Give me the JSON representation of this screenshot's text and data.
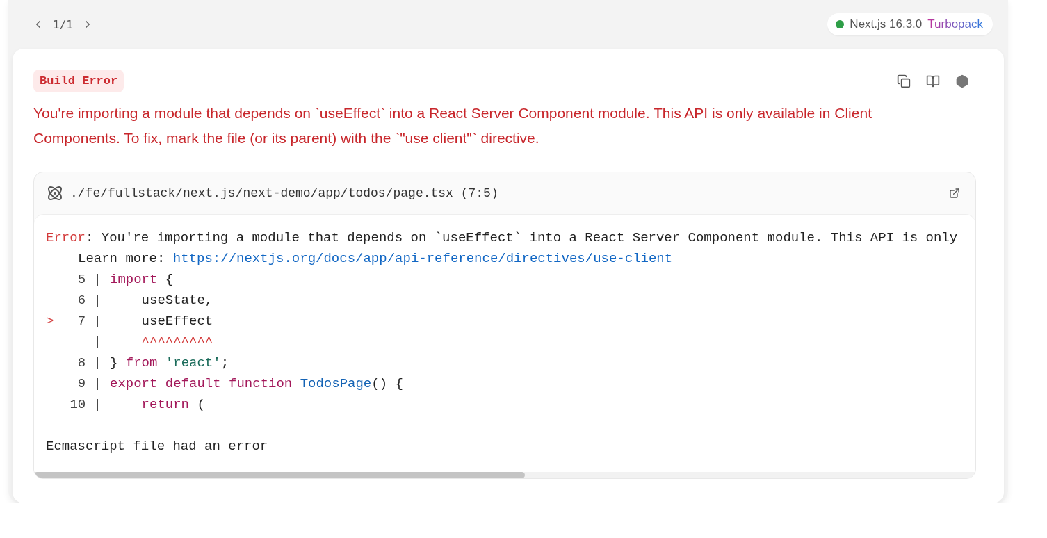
{
  "pager": {
    "count": "1/1"
  },
  "version_badge": {
    "version": "Next.js 16.3.0",
    "bundler": "Turbopack"
  },
  "error_label": "Build Error",
  "message": "You're importing a module that depends on `useEffect` into a React Server Component module. This API is only available in Client Components. To fix, mark the file (or its parent) with the `\"use client\"` directive.",
  "code_frame": {
    "file_path": "./fe/fullstack/next.js/next-demo/app/todos/page.tsx (7:5)",
    "lines": [
      {
        "kind": "error",
        "label": "Error",
        "text": ": You're importing a module that depends on `useEffect` into a React Server Component module. This API is only"
      },
      {
        "kind": "link",
        "label": "Learn more:",
        "text": "https://nextjs.org/docs/app/api-reference/directives/use-client"
      },
      {
        "kind": "code",
        "gutter": "5 |",
        "tokens": [
          {
            "t": "import",
            "kind": "keyword"
          },
          {
            "t": " {",
            "kind": "plain"
          }
        ]
      },
      {
        "kind": "code",
        "gutter": "6 |",
        "tokens": [
          {
            "t": "    useState,",
            "kind": "plain"
          }
        ]
      },
      {
        "kind": "code",
        "marker": ">",
        "gutter": "7 |",
        "tokens": [
          {
            "t": "    useEffect",
            "kind": "plain"
          }
        ]
      },
      {
        "kind": "code",
        "gutter": "|",
        "tokens": [
          {
            "t": "    ^^^^^^^^^",
            "kind": "caret"
          }
        ]
      },
      {
        "kind": "code",
        "gutter": "8 |",
        "tokens": [
          {
            "t": "} ",
            "kind": "plain"
          },
          {
            "t": "from ",
            "kind": "keyword"
          },
          {
            "t": "'react'",
            "kind": "string"
          },
          {
            "t": ";",
            "kind": "plain"
          }
        ]
      },
      {
        "kind": "code",
        "gutter": "9 |",
        "tokens": [
          {
            "t": "export default function ",
            "kind": "keyword"
          },
          {
            "t": "TodosPage",
            "kind": "fn"
          },
          {
            "t": "() {",
            "kind": "plain"
          }
        ]
      },
      {
        "kind": "code",
        "gutter": "10 |",
        "tokens": [
          {
            "t": "    return",
            "kind": "keyword"
          },
          {
            "t": " (",
            "kind": "plain"
          }
        ]
      },
      {
        "kind": "blank"
      },
      {
        "kind": "plain",
        "text": "Ecmascript file had an error"
      }
    ]
  }
}
